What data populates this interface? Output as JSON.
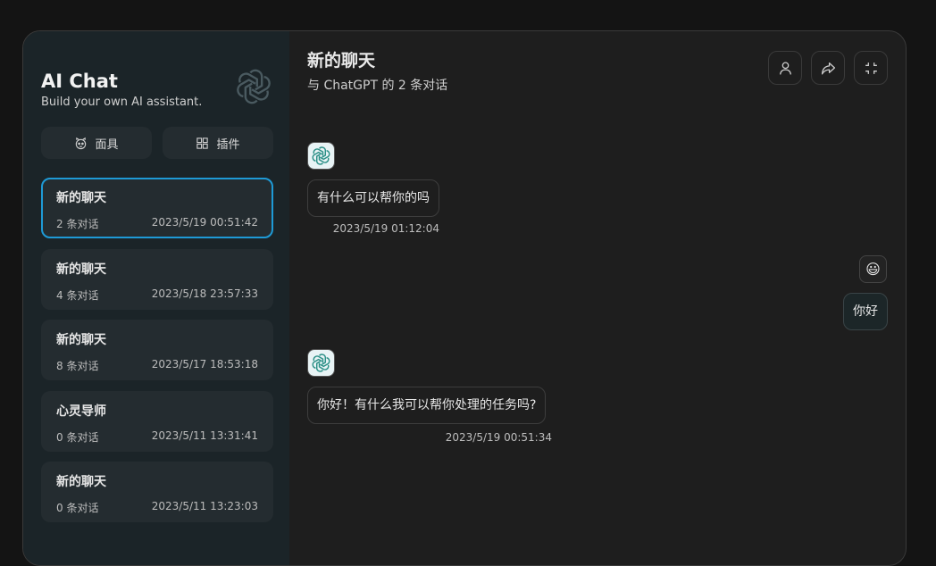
{
  "sidebar": {
    "title": "AI Chat",
    "subtitle": "Build your own AI assistant.",
    "tools": [
      {
        "label": "面具",
        "icon": "mask-icon"
      },
      {
        "label": "插件",
        "icon": "plugin-grid-icon"
      }
    ],
    "chats": [
      {
        "title": "新的聊天",
        "count": "2 条对话",
        "time": "2023/5/19 00:51:42",
        "active": true
      },
      {
        "title": "新的聊天",
        "count": "4 条对话",
        "time": "2023/5/18 23:57:33",
        "active": false
      },
      {
        "title": "新的聊天",
        "count": "8 条对话",
        "time": "2023/5/17 18:53:18",
        "active": false
      },
      {
        "title": "心灵导师",
        "count": "0 条对话",
        "time": "2023/5/11 13:31:41",
        "active": false
      },
      {
        "title": "新的聊天",
        "count": "0 条对话",
        "time": "2023/5/11 13:23:03",
        "active": false
      }
    ]
  },
  "main": {
    "title": "新的聊天",
    "subtitle": "与 ChatGPT 的 2 条对话",
    "actions": [
      "user-icon",
      "share-icon",
      "fullscreen-icon"
    ],
    "messages": [
      {
        "role": "bot",
        "text": "有什么可以帮你的吗",
        "time": "2023/5/19 01:12:04"
      },
      {
        "role": "user",
        "text": "你好",
        "avatar": "😃"
      },
      {
        "role": "bot",
        "text": "你好！有什么我可以帮你处理的任务吗?",
        "time": "2023/5/19 00:51:34"
      }
    ]
  },
  "colors": {
    "accent": "#1e9ad6",
    "sidebar_bg": "#1b2428",
    "main_bg": "#1e1e1e"
  }
}
